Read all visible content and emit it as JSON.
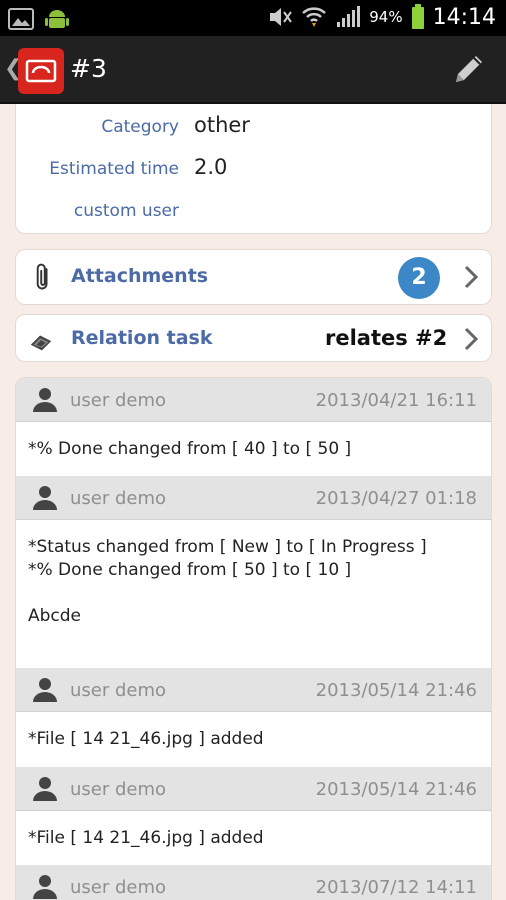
{
  "status_bar": {
    "battery_pct": "94%",
    "time": "14:14",
    "icons": [
      "gallery-icon",
      "android-icon",
      "mute-icon",
      "wifi-icon",
      "signal-icon",
      "battery-icon"
    ]
  },
  "action_bar": {
    "title": "#3",
    "back_glyph": "❮",
    "icons": [
      "app-logo-icon",
      "pencil-icon"
    ]
  },
  "details": {
    "category_label": "Category",
    "category_value": "other",
    "estimated_label": "Estimated time",
    "estimated_value": "2.0",
    "custom_label": "custom user",
    "custom_value": ""
  },
  "attachments": {
    "label": "Attachments",
    "count": "2",
    "icon": "paperclip-icon"
  },
  "relation": {
    "label": "Relation task",
    "value": "relates #2",
    "icon": "relation-icon"
  },
  "journal": [
    {
      "user": "user demo",
      "date": "2013/04/21 16:11",
      "lines": [
        "*% Done changed from [ 40 ] to [ 50 ]"
      ]
    },
    {
      "user": "user demo",
      "date": "2013/04/27 01:18",
      "lines": [
        "*Status changed from [ New ] to [ In Progress ]",
        "*% Done changed from [ 50 ] to [ 10 ]",
        "",
        "Abcde"
      ]
    },
    {
      "user": "user demo",
      "date": "2013/05/14 21:46",
      "lines": [
        "*File [ 14 21_46.jpg ] added"
      ]
    },
    {
      "user": "user demo",
      "date": "2013/05/14 21:46",
      "lines": [
        "*File [ 14 21_46.jpg ] added"
      ]
    },
    {
      "user": "user demo",
      "date": "2013/07/12 14:11",
      "lines": []
    }
  ],
  "colors": {
    "accent_blue": "#4b6aa6",
    "badge_blue": "#3b87c8",
    "logo_red": "#d8261e",
    "page_bg": "#f8ece6"
  }
}
